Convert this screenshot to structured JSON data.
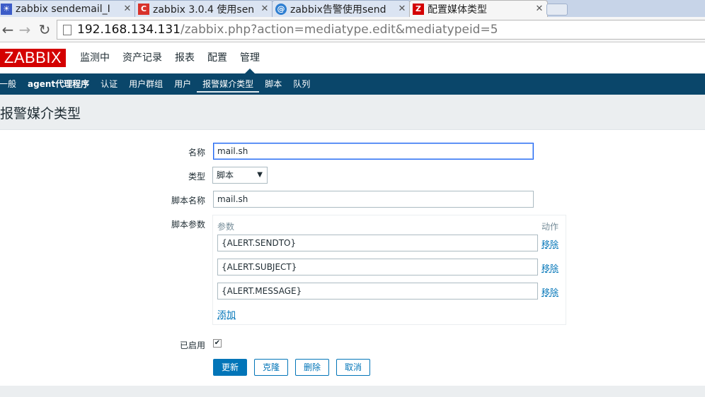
{
  "browser": {
    "tabs": [
      {
        "title": "zabbix sendemail_Ⅰ",
        "icon": "paw-icon",
        "color": "#3c5cc8",
        "glyph": "☀"
      },
      {
        "title": "zabbix 3.0.4 使用sen",
        "icon": "csdn-icon",
        "color": "#d8322b",
        "glyph": "C"
      },
      {
        "title": "zabbix告警使用send",
        "icon": "globe-icon",
        "color": "#2f7fd1",
        "glyph": "@"
      },
      {
        "title": "配置媒体类型",
        "icon": "zabbix-icon",
        "color": "#d40000",
        "glyph": "Z"
      }
    ],
    "url_host": "192.168.134.131",
    "url_path": "/zabbix.php?action=mediatype.edit&mediatypeid=5"
  },
  "header": {
    "logo": "ZABBIX",
    "menu": [
      "监测中",
      "资产记录",
      "报表",
      "配置",
      "管理"
    ]
  },
  "submenu": [
    "一般",
    "agent代理程序",
    "认证",
    "用户群组",
    "用户",
    "报警媒介类型",
    "脚本",
    "队列"
  ],
  "page_title": "报警媒介类型",
  "form": {
    "name_label": "名称",
    "name_value": "mail.sh",
    "type_label": "类型",
    "type_value": "脚本",
    "script_label": "脚本名称",
    "script_value": "mail.sh",
    "params_label": "脚本参数",
    "params_col": "参数",
    "action_col": "动作",
    "params": [
      "{ALERT.SENDTO}",
      "{ALERT.SUBJECT}",
      "{ALERT.MESSAGE}"
    ],
    "remove_label": "移除",
    "add_label": "添加",
    "enabled_label": "已启用",
    "enabled": true
  },
  "buttons": {
    "update": "更新",
    "clone": "克隆",
    "delete": "删除",
    "cancel": "取消"
  }
}
